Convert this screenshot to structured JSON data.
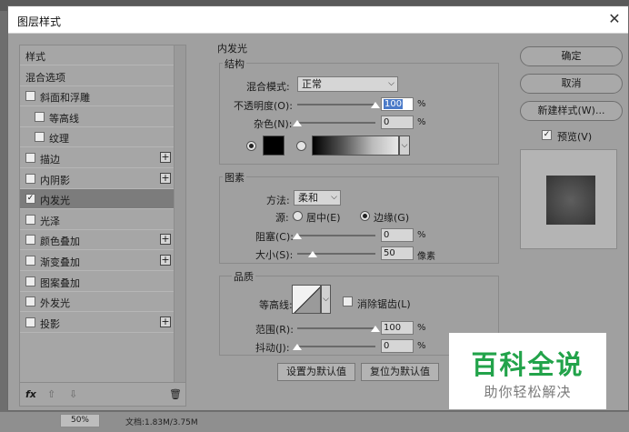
{
  "dialog": {
    "title": "图层样式",
    "close_label": "✕"
  },
  "styles_list": {
    "items": [
      {
        "label": "样式",
        "checkbox": false,
        "plus": false,
        "checked": false
      },
      {
        "label": "混合选项",
        "checkbox": false,
        "plus": false,
        "checked": false
      },
      {
        "label": "斜面和浮雕",
        "checkbox": true,
        "plus": false,
        "checked": false
      },
      {
        "label": "等高线",
        "checkbox": true,
        "plus": false,
        "checked": false,
        "indent": true
      },
      {
        "label": "纹理",
        "checkbox": true,
        "plus": false,
        "checked": false,
        "indent": true
      },
      {
        "label": "描边",
        "checkbox": true,
        "plus": true,
        "checked": false
      },
      {
        "label": "内阴影",
        "checkbox": true,
        "plus": true,
        "checked": false
      },
      {
        "label": "内发光",
        "checkbox": true,
        "plus": false,
        "checked": true,
        "selected": true
      },
      {
        "label": "光泽",
        "checkbox": true,
        "plus": false,
        "checked": false
      },
      {
        "label": "颜色叠加",
        "checkbox": true,
        "plus": true,
        "checked": false
      },
      {
        "label": "渐变叠加",
        "checkbox": true,
        "plus": true,
        "checked": false
      },
      {
        "label": "图案叠加",
        "checkbox": true,
        "plus": false,
        "checked": false
      },
      {
        "label": "外发光",
        "checkbox": true,
        "plus": false,
        "checked": false
      },
      {
        "label": "投影",
        "checkbox": true,
        "plus": true,
        "checked": false
      }
    ],
    "bottom": {
      "fx": "fx",
      "up": "⇧",
      "down": "⇩",
      "trash": "🗑"
    }
  },
  "inner_glow": {
    "title": "内发光",
    "structure": {
      "title": "结构",
      "blend_mode_label": "混合模式:",
      "blend_mode_value": "正常",
      "opacity_label": "不透明度(O):",
      "opacity_value": "100",
      "opacity_unit": "%",
      "opacity_level": 1.0,
      "noise_label": "杂色(N):",
      "noise_value": "0",
      "noise_unit": "%",
      "noise_level": 0.0
    },
    "elements": {
      "title": "图素",
      "method_label": "方法:",
      "method_value": "柔和",
      "source_label": "源:",
      "source_center": "居中(E)",
      "source_edge": "边缘(G)",
      "choke_label": "阻塞(C):",
      "choke_value": "0",
      "choke_unit": "%",
      "choke_level": 0.0,
      "size_label": "大小(S):",
      "size_value": "50",
      "size_unit": "像素",
      "size_level": 0.2
    },
    "quality": {
      "title": "品质",
      "contour_label": "等高线:",
      "antialias_label": "消除锯齿(L)",
      "range_label": "范围(R):",
      "range_value": "100",
      "range_unit": "%",
      "range_level": 1.0,
      "jitter_label": "抖动(J):",
      "jitter_value": "0",
      "jitter_unit": "%",
      "jitter_level": 0.0
    },
    "make_default": "设置为默认值",
    "reset_default": "复位为默认值"
  },
  "right": {
    "ok": "确定",
    "cancel": "取消",
    "new_style": "新建样式(W)...",
    "preview": "预览(V)"
  },
  "app_status": {
    "zoom": "50%",
    "doc": "文档:1.83M/3.75M"
  },
  "watermark": {
    "main": "百科全说",
    "sub": "助你轻松解决"
  }
}
